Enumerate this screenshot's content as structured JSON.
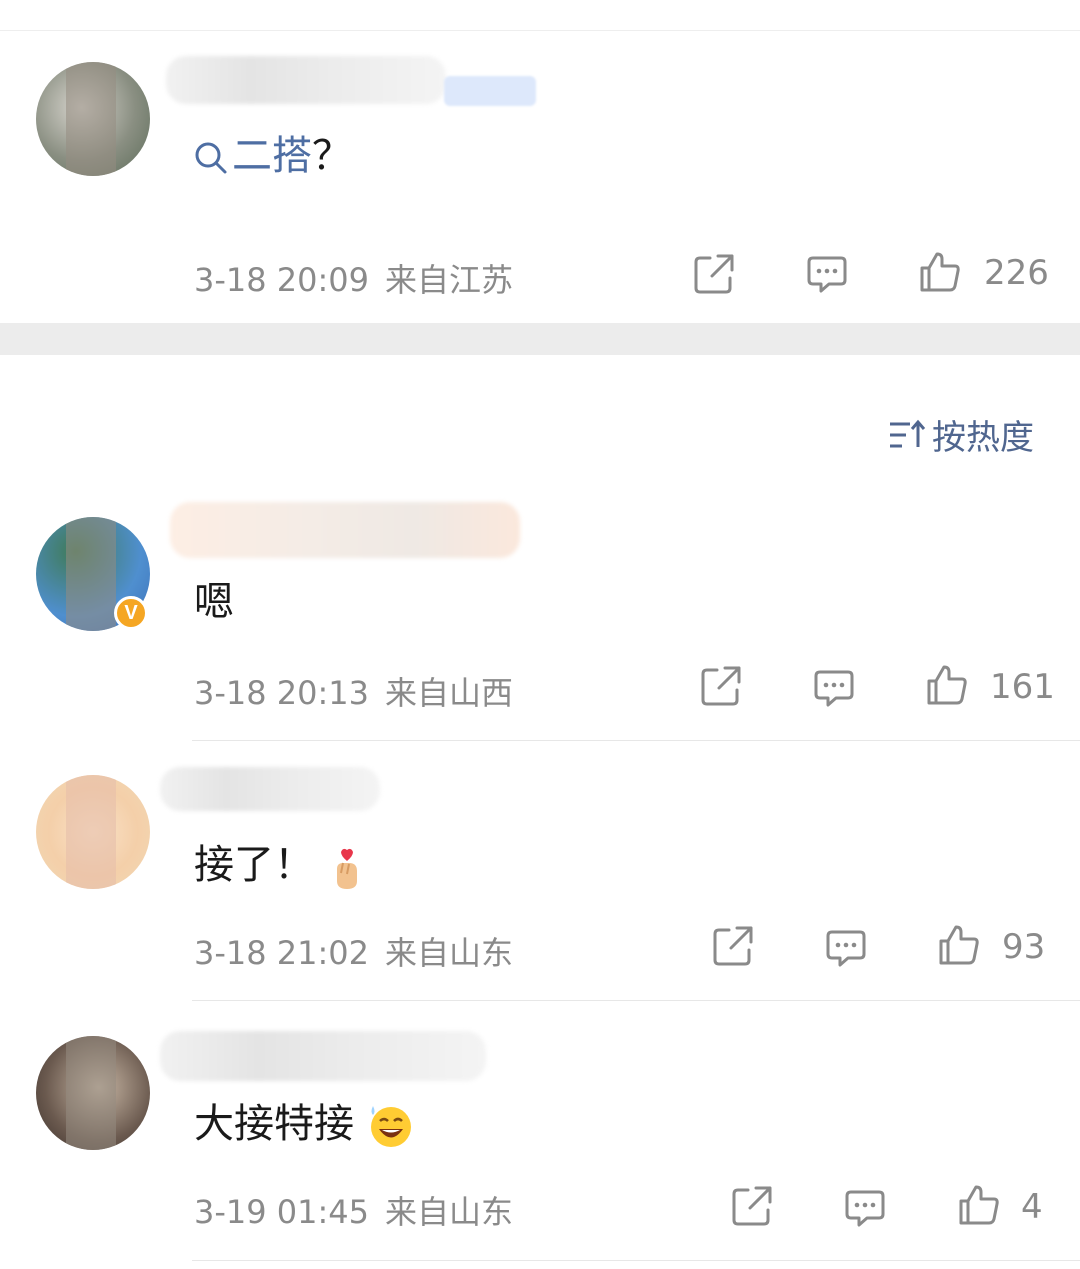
{
  "comments": [
    {
      "content_prefix_link": "二搭",
      "content_suffix": "？",
      "time": "3-18 20:09",
      "location": "来自江苏",
      "likes": "226"
    },
    {
      "content": "嗯",
      "time": "3-18 20:13",
      "location": "来自山西",
      "likes": "161",
      "verified_badge": "V"
    },
    {
      "content": "接了！",
      "time": "3-18 21:02",
      "location": "来自山东",
      "likes": "93",
      "emoji": "finger-heart-emoji"
    },
    {
      "content": "大接特接",
      "time": "3-19 01:45",
      "location": "来自山东",
      "likes": "4",
      "emoji": "grinning-tear-emoji"
    }
  ],
  "sort": {
    "label": "按热度",
    "icon": "sort-icon"
  },
  "colors": {
    "link": "#4e6ea3",
    "meta": "#8a8a8a",
    "divider": "#ececec",
    "badge": "#f5a623"
  }
}
